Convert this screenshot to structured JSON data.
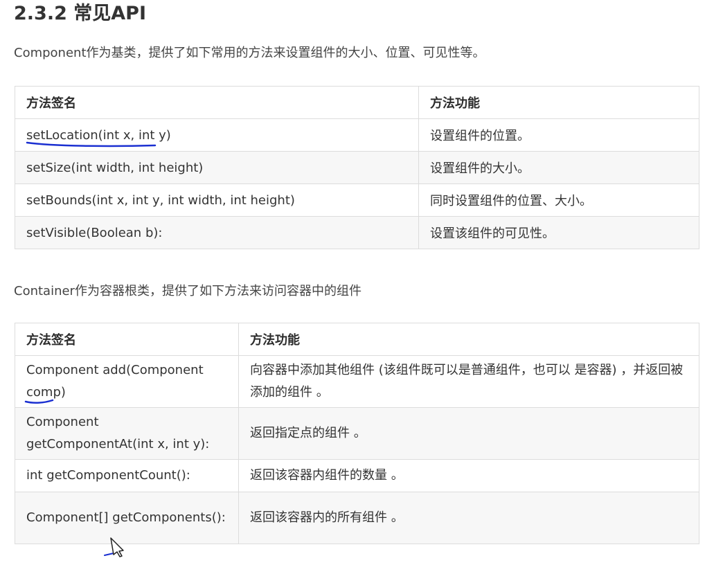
{
  "heading": "2.3.2 常见API",
  "component_intro": "Component作为基类，提供了如下常用的方法来设置组件的大小、位置、可见性等。",
  "container_intro": "Container作为容器根类，提供了如下方法来访问容器中的组件",
  "table1": {
    "headers": [
      "方法签名",
      "方法功能"
    ],
    "rows": [
      [
        "setLocation(int x, int y)",
        "设置组件的位置。"
      ],
      [
        "setSize(int width, int height)",
        "设置组件的大小。"
      ],
      [
        "setBounds(int x, int y, int width, int height)",
        "同时设置组件的位置、大小。"
      ],
      [
        "setVisible(Boolean b):",
        "设置该组件的可见性。"
      ]
    ]
  },
  "table2": {
    "headers": [
      "方法签名",
      "方法功能"
    ],
    "rows": [
      [
        "Component add(Component comp)",
        "向容器中添加其他组件 (该组件既可以是普通组件，也可以 是容器) ，并返回被添加的组件 。"
      ],
      [
        "Component getComponentAt(int x, int y):",
        "返回指定点的组件 。"
      ],
      [
        "int getComponentCount():",
        "返回该容器内组件的数量 。"
      ],
      [
        "Component[] getComponents():",
        "返回该容器内的所有组件 。"
      ]
    ]
  },
  "colors": {
    "text": "#333333",
    "border": "#dcdcdc",
    "alt_row": "#f7f7f7",
    "pen_ink": "#1a2fd1"
  },
  "icons": [
    "mouse-cursor-icon"
  ]
}
